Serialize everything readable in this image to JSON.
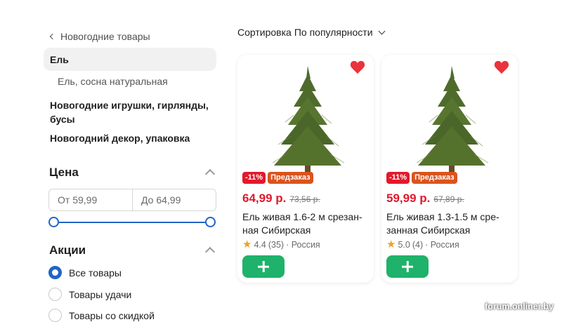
{
  "sidebar": {
    "back_label": "Новогодние товары",
    "categories": {
      "active": "Ель",
      "sub": "Ель, сосна натуральная",
      "toys": "Новогодние игрушки, гирлянды, бусы",
      "decor": "Новогодний декор, упаковка"
    },
    "price": {
      "title": "Цена",
      "from_placeholder": "От 59,99",
      "to_placeholder": "До 64,99",
      "range_min_fraction": 0,
      "range_max_fraction": 1
    },
    "promo": {
      "title": "Акции",
      "options": [
        "Все товары",
        "Товары удачи",
        "Товары со скидкой"
      ],
      "selected": "Все товары"
    }
  },
  "sort": {
    "label": "Сортировка",
    "value": "По популярности"
  },
  "products": [
    {
      "discount": "-11%",
      "preorder": "Предзаказ",
      "price": "64,99 р.",
      "old_price": "73,56 р.",
      "title": "Ель живая 1.6-2 м срезан-ная Сибирская",
      "rating": "4.4",
      "reviews": "(35)",
      "origin": "· Россия"
    },
    {
      "discount": "-11%",
      "preorder": "Предзаказ",
      "price": "59,99 р.",
      "old_price": "67,89 р.",
      "title": "Ель живая 1.3-1.5 м сре-занная Сибирская",
      "rating": "5.0",
      "reviews": "(4)",
      "origin": "· Россия"
    }
  ],
  "watermark": "forum.onliner.by",
  "colors": {
    "accent_blue": "#2264c5",
    "price_red": "#e2192c",
    "preorder_orange": "#d9541e",
    "add_green": "#1eb26a",
    "heart_red": "#e8343a"
  },
  "icons": [
    "chevron-left-icon",
    "caret-up-icon",
    "chevron-down-icon",
    "heart-icon",
    "star-icon",
    "plus-icon"
  ]
}
